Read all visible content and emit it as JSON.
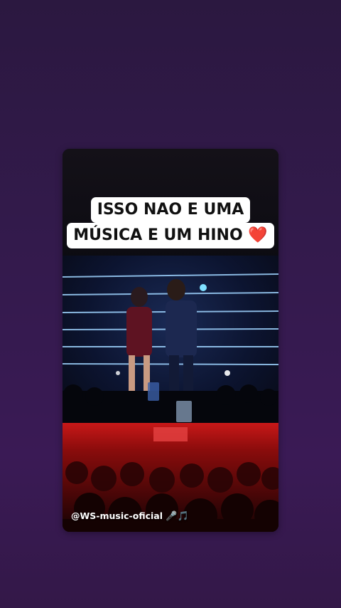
{
  "story": {
    "caption_line1": "ISSO NAO E UMA",
    "caption_line2": "MÚSICA E UM HINO",
    "caption_emoji": "❤️",
    "watermark": "@WS-music-oficial",
    "watermark_icons": "🎤🎵"
  },
  "colors": {
    "background_top": "#2b1840",
    "background_bottom": "#3a1a55",
    "caption_bg": "#ffffff",
    "heart": "#e02424"
  }
}
